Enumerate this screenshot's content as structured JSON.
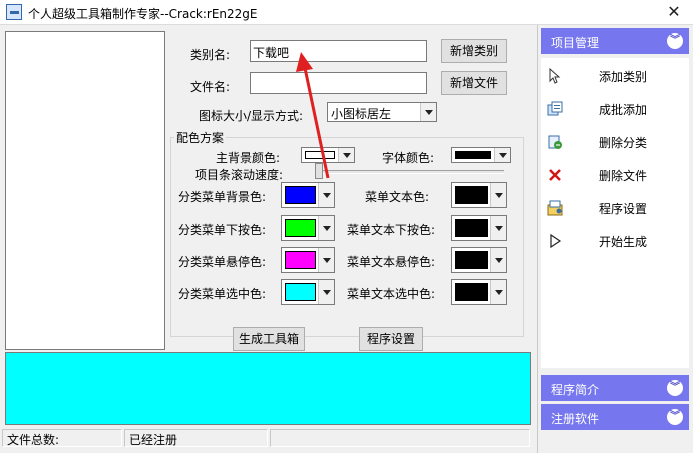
{
  "window": {
    "title": "个人超级工具箱制作专家--Crack:rEn22gE",
    "close_glyph": "✕"
  },
  "form": {
    "category_label": "类别名:",
    "category_value": "下载吧",
    "add_category_button": "新增类别",
    "file_label": "文件名:",
    "file_value": "",
    "add_file_button": "新增文件",
    "icon_mode_label": "图标大小/显示方式:",
    "icon_mode_value": "小图标居左"
  },
  "color_scheme": {
    "title": "配色方案",
    "main_bg_label": "主背景颜色:",
    "font_color_label": "字体颜色:",
    "scroll_speed_label": "项目条滚动速度:",
    "rows": [
      {
        "left_label": "分类菜单背景色:",
        "left_color": "#0000ff",
        "right_label": "菜单文本色:",
        "right_color": "#000000"
      },
      {
        "left_label": "分类菜单下按色:",
        "left_color": "#00ff00",
        "right_label": "菜单文本下按色:",
        "right_color": "#000000"
      },
      {
        "left_label": "分类菜单悬停色:",
        "left_color": "#ff00ff",
        "right_label": "菜单文本悬停色:",
        "right_color": "#000000"
      },
      {
        "left_label": "分类菜单选中色:",
        "left_color": "#00ffff",
        "right_label": "菜单文本选中色:",
        "right_color": "#000000"
      }
    ],
    "main_bg_color": "#ffffff",
    "font_color": "#000000"
  },
  "actions": {
    "generate_button": "生成工具箱",
    "settings_button": "程序设置"
  },
  "preview": {
    "color": "#00ffff"
  },
  "status": {
    "file_total_label": "文件总数:",
    "registered_text": "已经注册"
  },
  "side_panel": {
    "project_header": "项目管理",
    "items": [
      {
        "label": "添加类别",
        "icon": "cursor-icon"
      },
      {
        "label": "成批添加",
        "icon": "batch-add-icon"
      },
      {
        "label": "删除分类",
        "icon": "delete-category-icon"
      },
      {
        "label": "删除文件",
        "icon": "delete-x-icon"
      },
      {
        "label": "程序设置",
        "icon": "settings-icon"
      },
      {
        "label": "开始生成",
        "icon": "play-icon"
      }
    ],
    "intro_header": "程序简介",
    "register_header": "注册软件",
    "chevron_glyph": "︾"
  },
  "colors": {
    "panel_header": "#7676ee",
    "annotation_arrow": "#e02020"
  }
}
